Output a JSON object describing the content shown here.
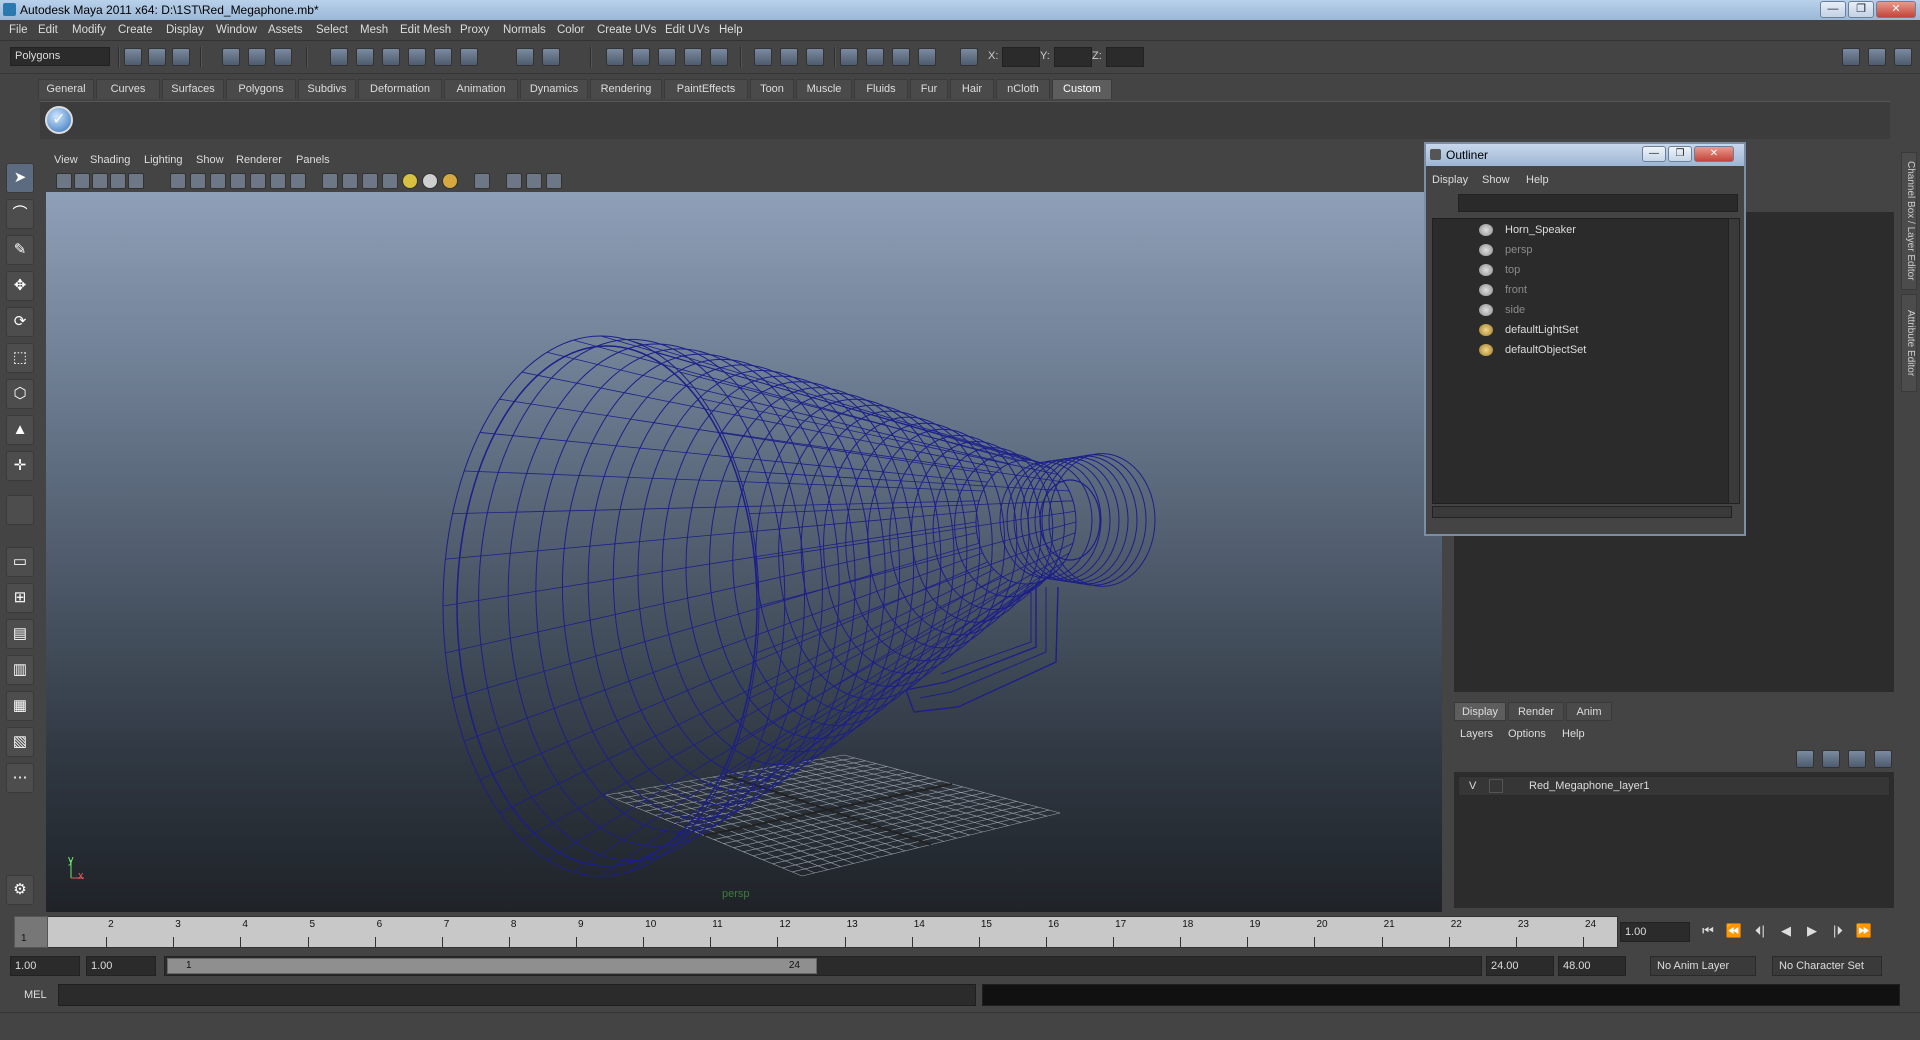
{
  "window": {
    "title": "Autodesk Maya 2011 x64: D:\\1ST\\Red_Megaphone.mb*",
    "min": "—",
    "max": "❐",
    "close": "✕"
  },
  "menus": [
    "File",
    "Edit",
    "Modify",
    "Create",
    "Display",
    "Window",
    "Assets",
    "Select",
    "Mesh",
    "Edit Mesh",
    "Proxy",
    "Normals",
    "Color",
    "Create UVs",
    "Edit UVs",
    "Help"
  ],
  "statusline": {
    "mode": "Polygons",
    "x_label": "X:",
    "y_label": "Y:",
    "z_label": "Z:"
  },
  "shelf": {
    "tabs": [
      "General",
      "Curves",
      "Surfaces",
      "Polygons",
      "Subdivs",
      "Deformation",
      "Animation",
      "Dynamics",
      "Rendering",
      "PaintEffects",
      "Toon",
      "Muscle",
      "Fluids",
      "Fur",
      "Hair",
      "nCloth",
      "Custom"
    ],
    "active_tab": "Custom",
    "check_icon": "✓"
  },
  "viewport": {
    "menus": [
      "View",
      "Shading",
      "Lighting",
      "Show",
      "Renderer",
      "Panels"
    ],
    "camera_label": "persp",
    "axis_y": "y",
    "axis_x": "x",
    "wire_color": "#1c1f8a",
    "grid_color": "#9aa0a8"
  },
  "outliner": {
    "title": "Outliner",
    "menus": [
      "Display",
      "Show",
      "Help"
    ],
    "items": [
      {
        "label": "Horn_Speaker",
        "dim": false
      },
      {
        "label": "persp",
        "dim": true
      },
      {
        "label": "top",
        "dim": true
      },
      {
        "label": "front",
        "dim": true
      },
      {
        "label": "side",
        "dim": true
      },
      {
        "label": "defaultLightSet",
        "dim": false
      },
      {
        "label": "defaultObjectSet",
        "dim": false
      }
    ]
  },
  "layer_editor": {
    "tabs": [
      "Display",
      "Render",
      "Anim"
    ],
    "active_tab": "Display",
    "menus": [
      "Layers",
      "Options",
      "Help"
    ],
    "layer": {
      "visible": "V",
      "name": "Red_Megaphone_layer1"
    }
  },
  "side_tabs": [
    "Channel Box / Layer Editor",
    "Attribute Editor"
  ],
  "timeline": {
    "ticks": [
      "1",
      "2",
      "3",
      "4",
      "5",
      "6",
      "7",
      "8",
      "9",
      "10",
      "11",
      "12",
      "13",
      "14",
      "15",
      "16",
      "17",
      "18",
      "19",
      "20",
      "21",
      "22",
      "23",
      "24"
    ],
    "current_frame_marker": "1",
    "current_frame": "1.00",
    "playback_buttons": [
      "⏮",
      "⏪",
      "⏴|",
      "◀",
      "▶",
      "|⏵",
      "⏩"
    ]
  },
  "range": {
    "start_time": "1.00",
    "playback_start": "1.00",
    "handle_start": "1",
    "handle_end": "24",
    "playback_end": "24.00",
    "end_time": "48.00",
    "anim_layer": "No Anim Layer",
    "character_set": "No Character Set"
  },
  "command": {
    "mel_label": "MEL"
  }
}
